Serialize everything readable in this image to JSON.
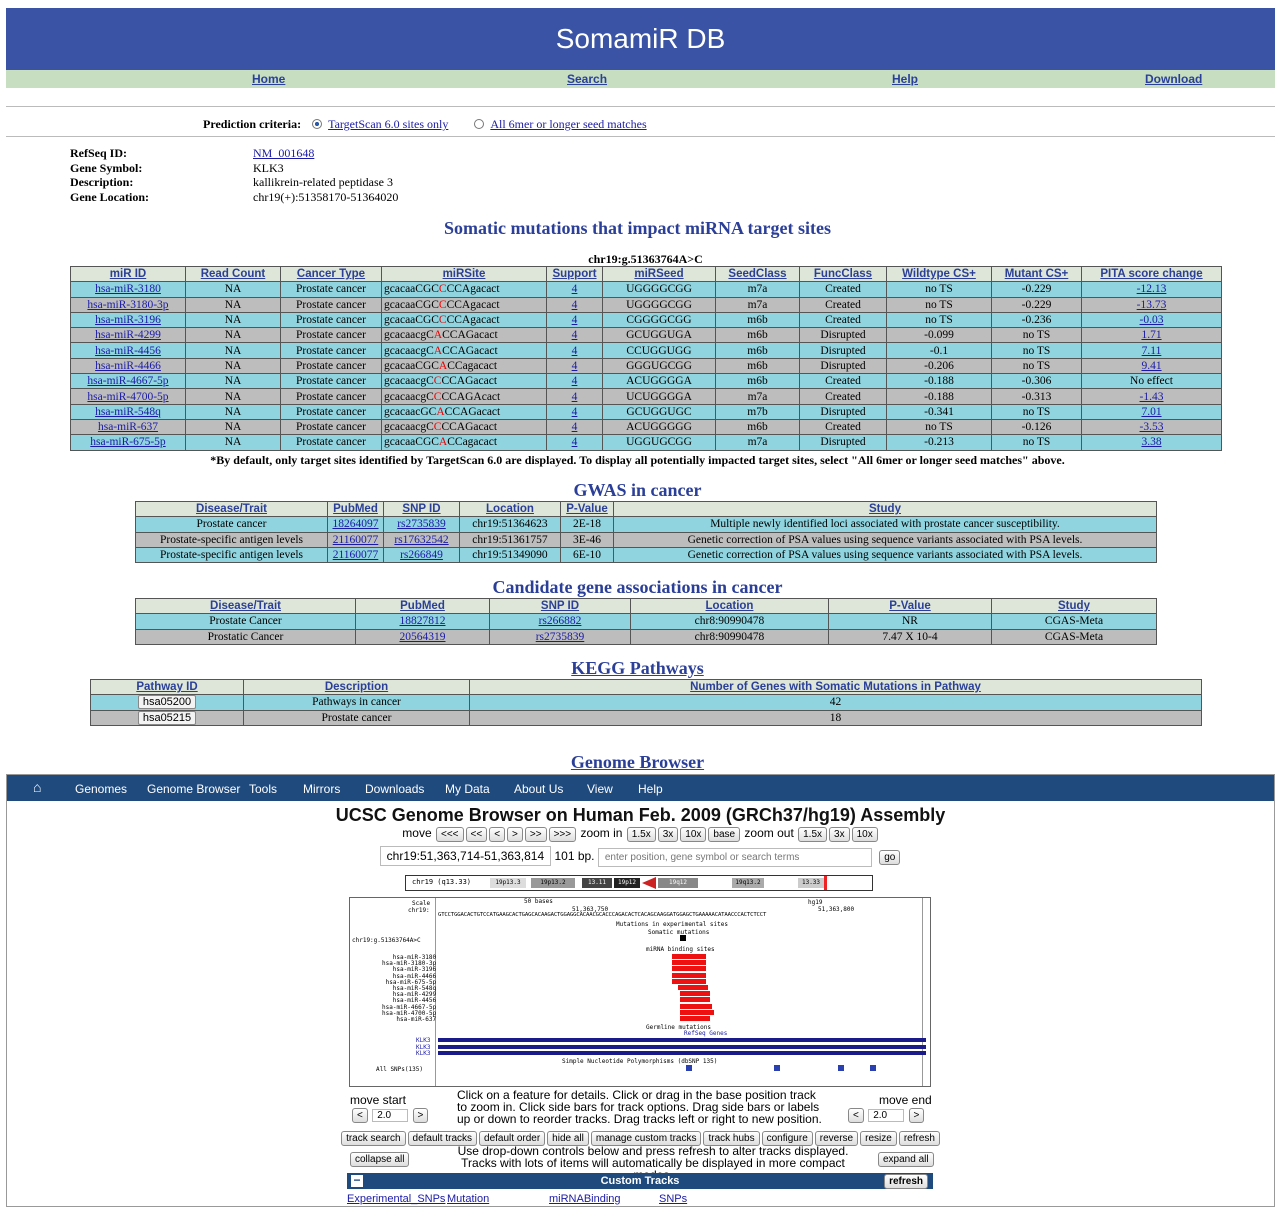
{
  "header": {
    "title": "SomamiR DB"
  },
  "nav": {
    "home": "Home",
    "search": "Search",
    "help": "Help",
    "download": "Download"
  },
  "criteria": {
    "label": "Prediction criteria:",
    "opt1": "TargetScan 6.0 sites only",
    "opt2": "All 6mer or longer seed matches"
  },
  "gene": {
    "refseq_label": "RefSeq ID:",
    "refseq": "NM_001648",
    "symbol_label": "Gene Symbol:",
    "symbol": "KLK3",
    "desc_label": "Description:",
    "desc": "kallikrein-related peptidase 3",
    "loc_label": "Gene Location:",
    "loc": "chr19(+):51358170-51364020"
  },
  "somatic": {
    "title": "Somatic mutations that impact miRNA target sites",
    "caption": "chr19:g.51363764A>C",
    "headers": [
      "miR ID",
      "Read Count",
      "Cancer Type",
      "miRSite",
      "Support",
      "miRSeed",
      "SeedClass",
      "FuncClass",
      "Wildtype CS+",
      "Mutant CS+",
      "PITA score change"
    ],
    "rows": [
      [
        "hsa-miR-3180",
        "NA",
        "Prostate cancer",
        [
          "gcacaaCGC",
          "C",
          "CCAgacact"
        ],
        "4",
        "UGGGGCGG",
        "m7a",
        "Created",
        "no TS",
        "-0.229",
        "-12.13"
      ],
      [
        "hsa-miR-3180-3p",
        "NA",
        "Prostate cancer",
        [
          "gcacaaCGC",
          "C",
          "CCAgacact"
        ],
        "4",
        "UGGGGCGG",
        "m7a",
        "Created",
        "no TS",
        "-0.229",
        "-13.73"
      ],
      [
        "hsa-miR-3196",
        "NA",
        "Prostate cancer",
        [
          "gcacaaCGC",
          "C",
          "CCAgacact"
        ],
        "4",
        "CGGGGCGG",
        "m6b",
        "Created",
        "no TS",
        "-0.236",
        "-0.03"
      ],
      [
        "hsa-miR-4299",
        "NA",
        "Prostate cancer",
        [
          "gcacaacgC",
          "A",
          "CCAGacact"
        ],
        "4",
        "GCUGGUGA",
        "m6b",
        "Disrupted",
        "-0.099",
        "no TS",
        "1.71"
      ],
      [
        "hsa-miR-4456",
        "NA",
        "Prostate cancer",
        [
          "gcacaacgC",
          "A",
          "CCAGacact"
        ],
        "4",
        "CCUGGUGG",
        "m6b",
        "Disrupted",
        "-0.1",
        "no TS",
        "7.11"
      ],
      [
        "hsa-miR-4466",
        "NA",
        "Prostate cancer",
        [
          "gcacaaCGC",
          "A",
          "CCagacact"
        ],
        "4",
        "GGGUGCGG",
        "m6b",
        "Disrupted",
        "-0.206",
        "no TS",
        "9.41"
      ],
      [
        "hsa-miR-4667-5p",
        "NA",
        "Prostate cancer",
        [
          "gcacaacgC",
          "C",
          "CCAGacact"
        ],
        "4",
        "ACUGGGGA",
        "m6b",
        "Created",
        "-0.188",
        "-0.306",
        "No effect"
      ],
      [
        "hsa-miR-4700-5p",
        "NA",
        "Prostate cancer",
        [
          "gcacaacgC",
          "C",
          "CCAGAcact"
        ],
        "4",
        "UCUGGGGA",
        "m7a",
        "Created",
        "-0.188",
        "-0.313",
        "-1.43"
      ],
      [
        "hsa-miR-548q",
        "NA",
        "Prostate cancer",
        [
          "gcacaacGC",
          "A",
          "CCAGacact"
        ],
        "4",
        "GCUGGUGC",
        "m7b",
        "Disrupted",
        "-0.341",
        "no TS",
        "7.01"
      ],
      [
        "hsa-miR-637",
        "NA",
        "Prostate cancer",
        [
          "gcacaacgC",
          "C",
          "CCAGacact"
        ],
        "4",
        "ACUGGGGG",
        "m6b",
        "Created",
        "no TS",
        "-0.126",
        "-3.53"
      ],
      [
        "hsa-miR-675-5p",
        "NA",
        "Prostate cancer",
        [
          "gcacaaCGC",
          "A",
          "CCagacact"
        ],
        "4",
        "UGGUGCGG",
        "m7a",
        "Disrupted",
        "-0.213",
        "no TS",
        "3.38"
      ]
    ],
    "note": "*By default, only target sites identified by TargetScan 6.0 are displayed. To display all potentially impacted target sites, select \"All 6mer or longer seed matches\" above."
  },
  "gwas": {
    "title": "GWAS in cancer",
    "headers": [
      "Disease/Trait",
      "PubMed",
      "SNP ID",
      "Location",
      "P-Value",
      "Study"
    ],
    "rows": [
      [
        "Prostate cancer",
        "18264097",
        "rs2735839",
        "chr19:51364623",
        "2E-18",
        "Multiple newly identified loci associated with prostate cancer susceptibility."
      ],
      [
        "Prostate-specific antigen levels",
        "21160077",
        "rs17632542",
        "chr19:51361757",
        "3E-46",
        "Genetic correction of PSA values using sequence variants associated with PSA levels."
      ],
      [
        "Prostate-specific antigen levels",
        "21160077",
        "rs266849",
        "chr19:51349090",
        "6E-10",
        "Genetic correction of PSA values using sequence variants associated with PSA levels."
      ]
    ]
  },
  "candidate": {
    "title": "Candidate gene associations in cancer",
    "headers": [
      "Disease/Trait",
      "PubMed",
      "SNP ID",
      "Location",
      "P-Value",
      "Study"
    ],
    "rows": [
      [
        "Prostate Cancer",
        "18827812",
        "rs266882",
        "chr8:90990478",
        "NR",
        "CGAS-Meta"
      ],
      [
        "Prostatic Cancer",
        "20564319",
        "rs2735839",
        "chr8:90990478",
        "7.47 X 10-4",
        "CGAS-Meta"
      ]
    ]
  },
  "kegg": {
    "title": "KEGG Pathways",
    "headers": [
      "Pathway ID",
      "Description",
      "Number of Genes with Somatic Mutations in Pathway"
    ],
    "rows": [
      [
        "hsa05200",
        "Pathways in cancer",
        "42"
      ],
      [
        "hsa05215",
        "Prostate cancer",
        "18"
      ]
    ]
  },
  "genome": {
    "section_title": "Genome Browser",
    "nav": [
      "Genomes",
      "Genome Browser",
      "Tools",
      "Mirrors",
      "Downloads",
      "My Data",
      "About Us",
      "View",
      "Help"
    ],
    "title": "UCSC Genome Browser on Human Feb. 2009 (GRCh37/hg19) Assembly",
    "move_label": "move",
    "zoom_in_label": "zoom in",
    "zoom_out_label": "zoom out",
    "move_buttons": [
      "<<<",
      "<<",
      "<",
      ">",
      ">>",
      ">>>"
    ],
    "zoom_in": [
      "1.5x",
      "3x",
      "10x",
      "base"
    ],
    "zoom_out": [
      "1.5x",
      "3x",
      "10x"
    ],
    "position": "chr19:51,363,714-51,363,814",
    "bp": "101 bp.",
    "search_placeholder": "enter position, gene symbol or search terms",
    "go": "go",
    "ideogram_label": "chr19 (q13.33)",
    "bands": [
      "19p13.3",
      "19p13.2",
      "13.11",
      "19p12",
      "19q12",
      "19q13.2",
      "13.33"
    ],
    "track": {
      "scale": "Scale",
      "chrom": "chr19:",
      "bases": "50 bases",
      "assembly": "hg19",
      "coord1": "51,363,750",
      "coord2": "51,363,800",
      "seq": "GTCCTGGACACTGTCCATGAAGCACTGAGCACAAGACTGGAGGCACAACGCACCCAGACACTCACAGCAAGGATGGAGCTGAAAAACATAACCCACTCTCCT",
      "exp_sites": "Mutations in experimental sites",
      "somatic": "Somatic mutations",
      "mut_label": "chr19:g.51363764A>C",
      "mirna_sites": "miRNA binding sites",
      "mirs": [
        "hsa-miR-3180",
        "hsa-miR-3180-3p",
        "hsa-miR-3196",
        "hsa-miR-4466",
        "hsa-miR-675-5p",
        "hsa-miR-548q",
        "hsa-miR-4299",
        "hsa-miR-4456",
        "hsa-miR-4667-5p",
        "hsa-miR-4700-5p",
        "hsa-miR-637"
      ],
      "germline": "Germline mutations",
      "refseq": "RefSeq Genes",
      "klk": [
        "KLK3",
        "KLK3",
        "KLK3"
      ],
      "snp_track": "Simple Nucleotide Polymorphisms (dbSNP 135)",
      "all_snps": "All SNPs(135)"
    },
    "move_start": "move start",
    "move_end": "move end",
    "move_val": "2.0",
    "help_text1": "Click on a feature for details. Click or drag in the base position track to zoom in. Click side bars for track options. Drag side bars or labels up or down to reorder tracks. Drag tracks left or right to new position.",
    "buttons": [
      "track search",
      "default tracks",
      "default order",
      "hide all",
      "manage custom tracks",
      "track hubs",
      "configure",
      "reverse",
      "resize",
      "refresh"
    ],
    "collapse": "collapse all",
    "expand": "expand all",
    "help_text2": "Use drop-down controls below and press refresh to alter tracks displayed.",
    "help_text3": "Tracks with lots of items will automatically be displayed in more compact modes.",
    "custom_tracks": "Custom Tracks",
    "refresh": "refresh",
    "minus": "−",
    "ct_items": [
      "Experimental_SNPs",
      "Mutation",
      "miRNABinding",
      "SNPs"
    ]
  },
  "colors": {
    "banner": "#3a53a4",
    "row_cyan": "#8fd4df",
    "row_gray": "#bdbdbd",
    "mutation": "#e00000",
    "gb_nav": "#1f4a7e"
  }
}
